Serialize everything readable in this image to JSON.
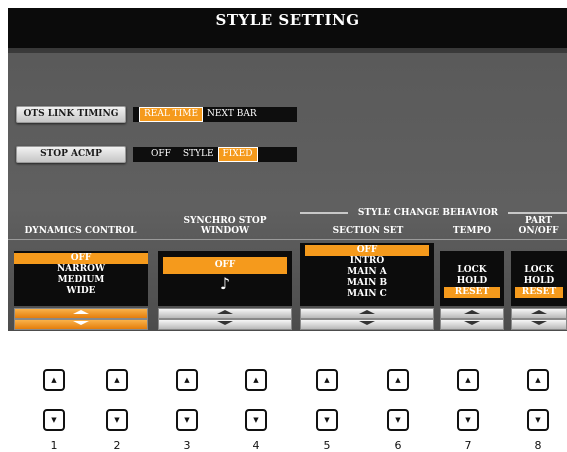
{
  "title": "STYLE SETTING",
  "ots_link": {
    "label": "OTS LINK TIMING",
    "options": [
      "REAL TIME",
      "NEXT BAR"
    ],
    "selected": "REAL TIME"
  },
  "stop_acmp": {
    "label": "STOP ACMP",
    "options": [
      "OFF",
      "STYLE",
      "FIXED"
    ],
    "selected": "FIXED"
  },
  "group_label": "STYLE CHANGE BEHAVIOR",
  "dynamics": {
    "header": "DYNAMICS CONTROL",
    "items": [
      "OFF",
      "NARROW",
      "MEDIUM",
      "WIDE"
    ],
    "selected": "OFF"
  },
  "synchro": {
    "header_line1": "SYNCHRO STOP",
    "header_line2": "WINDOW",
    "value": "OFF",
    "note_icon": "eighth-note-icon",
    "note_glyph": "♪"
  },
  "section_set": {
    "header": "SECTION SET",
    "items": [
      "OFF",
      "INTRO",
      "MAIN A",
      "MAIN B",
      "MAIN C"
    ],
    "selected": "OFF"
  },
  "tempo": {
    "header": "TEMPO",
    "items": [
      "LOCK",
      "HOLD",
      "RESET"
    ],
    "selected": "RESET"
  },
  "part": {
    "header_line1": "PART",
    "header_line2": "ON/OFF",
    "items": [
      "LOCK",
      "HOLD",
      "RESET"
    ],
    "selected": "RESET"
  },
  "hardware": {
    "up_glyph": "▲",
    "down_glyph": "▼",
    "numbers": [
      "1",
      "2",
      "3",
      "4",
      "5",
      "6",
      "7",
      "8"
    ]
  },
  "colors": {
    "accent": "#f59a1c",
    "panel": "#0c0c0c",
    "screen": "#5a5a5a"
  }
}
